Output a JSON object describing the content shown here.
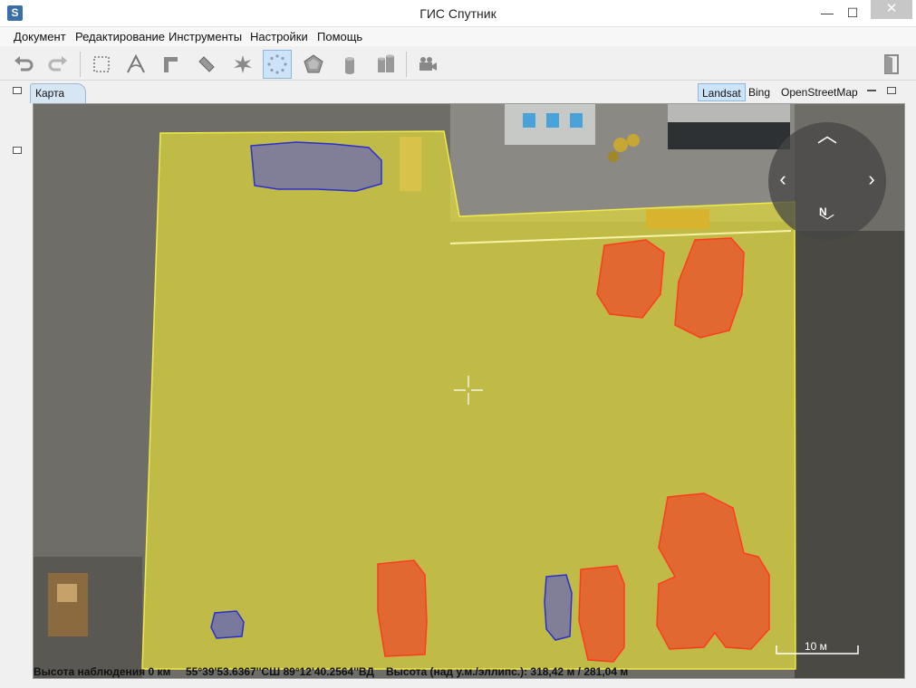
{
  "window": {
    "title": "ГИС Спутник",
    "app_icon_letter": "S",
    "minimize": "—",
    "maximize": "☐",
    "close": "✕"
  },
  "menu": [
    "Документ",
    "Редактирование",
    "Инструменты",
    "Настройки",
    "Помощь"
  ],
  "toolbar": {
    "tools": [
      "undo-icon",
      "redo-icon",
      "select-rect-icon",
      "angle-icon",
      "corner-icon",
      "ruler-icon",
      "star-burst-icon",
      "point-circle-icon",
      "pentagon-icon",
      "cylinder-icon",
      "cylinders-icon",
      "video-camera-icon"
    ],
    "active_tool": "point-circle-icon",
    "right_tool": "exit-door-icon"
  },
  "tab": {
    "label": "Карта"
  },
  "layers": {
    "items": [
      "Landsat",
      "Bing",
      "OpenStreetMap"
    ],
    "active": "Landsat"
  },
  "navigator": {
    "north_label": "N"
  },
  "scale": {
    "label": "10 м"
  },
  "status": {
    "altitude": "Высота наблюдения 0 км",
    "coords": "55°39'53.6367''СШ 89°12'40.2564''ВД",
    "elevation": "Высота (над у.м./эллипс.): 318,42 м / 281,04 м"
  },
  "colors": {
    "zone_fill": "#e3db3a",
    "zone_stroke": "#f0ea4a",
    "danger_fill": "#e9542c",
    "danger_stroke": "#ff3b1f",
    "vehicle_fill": "#4a4fd8",
    "vehicle_stroke": "#2a2fd0",
    "accent": "#cde3f7"
  }
}
